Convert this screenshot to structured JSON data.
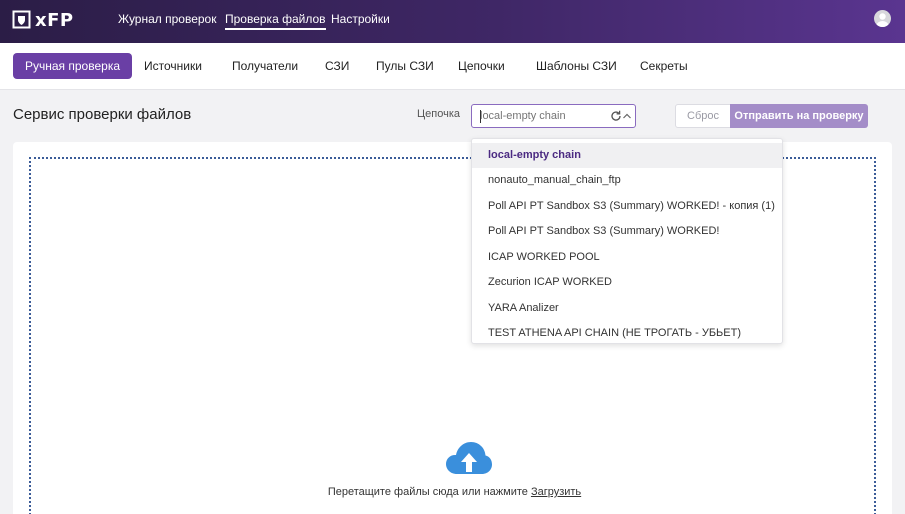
{
  "app": {
    "logo_text": "xFP"
  },
  "topnav": [
    {
      "label": "Журнал проверок"
    },
    {
      "label": "Проверка файлов",
      "active": true
    },
    {
      "label": "Настройки"
    }
  ],
  "subnav": [
    {
      "label": "Ручная проверка",
      "active": true
    },
    {
      "label": "Источники"
    },
    {
      "label": "Получатели"
    },
    {
      "label": "СЗИ"
    },
    {
      "label": "Пулы СЗИ"
    },
    {
      "label": "Цепочки"
    },
    {
      "label": "Шаблоны СЗИ"
    },
    {
      "label": "Секреты"
    }
  ],
  "page": {
    "title": "Сервис проверки файлов"
  },
  "chain": {
    "label": "Цепочка",
    "placeholder": "local-empty chain",
    "options": [
      "local-empty chain",
      "nonauto_manual_chain_ftp",
      "Poll API PT Sandbox S3 (Summary) WORKED! - копия (1)",
      "Poll API PT Sandbox S3 (Summary) WORKED!",
      "ICAP WORKED POOL",
      "Zecurion ICAP WORKED",
      "YARA Analizer",
      "TEST ATHENA API CHAIN (НЕ ТРОГАТЬ - УБЬЕТ)"
    ],
    "selected_index": 0
  },
  "actions": {
    "reset_label": "Сброс",
    "submit_label": "Отправить на проверку"
  },
  "dropzone": {
    "text": "Перетащите файлы сюда или нажмите",
    "link_label": "Загрузить"
  },
  "colors": {
    "accent": "#6a3fa5",
    "header": "#3f2766",
    "cloud": "#3a8fdc"
  }
}
